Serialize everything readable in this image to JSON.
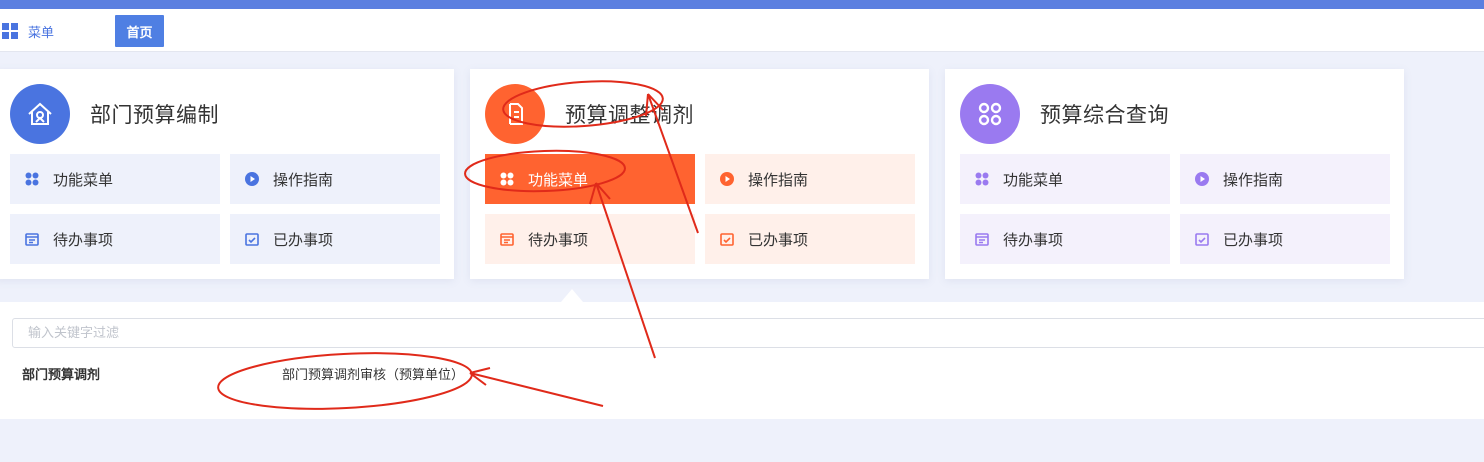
{
  "navbar": {
    "menu_label": "菜单",
    "home_tab": "首页"
  },
  "cards": [
    {
      "title": "部门预算编制",
      "theme": "blue",
      "tiles": {
        "function_menu": "功能菜单",
        "guide": "操作指南",
        "todo": "待办事项",
        "done": "已办事项"
      }
    },
    {
      "title": "预算调整调剂",
      "theme": "orange",
      "tiles": {
        "function_menu": "功能菜单",
        "guide": "操作指南",
        "todo": "待办事项",
        "done": "已办事项"
      }
    },
    {
      "title": "预算综合查询",
      "theme": "purple",
      "tiles": {
        "function_menu": "功能菜单",
        "guide": "操作指南",
        "todo": "待办事项",
        "done": "已办事项"
      }
    }
  ],
  "colors": {
    "brand_blue": "#4f7fe3",
    "orange": "#ff6330",
    "purple": "#9a7af0",
    "annotation_red": "#e02a1a"
  },
  "panel": {
    "filter_placeholder": "输入关键字过滤",
    "group_title": "部门预算调剂",
    "menu_item": "部门预算调剂审核（预算单位）"
  }
}
